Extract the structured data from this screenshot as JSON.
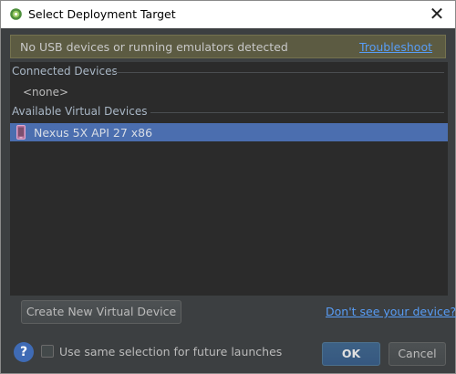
{
  "window": {
    "title": "Select Deployment Target",
    "close_glyph": "✕"
  },
  "banner": {
    "message": "No USB devices or running emulators detected",
    "link": "Troubleshoot"
  },
  "connected_devices": {
    "header": "Connected Devices",
    "empty_label": "<none>"
  },
  "available_virtual_devices": {
    "header": "Available Virtual Devices",
    "items": [
      {
        "label": "Nexus 5X API 27 x86",
        "icon": "phone-icon",
        "selected": true
      }
    ]
  },
  "actions": {
    "create_button": "Create New Virtual Device",
    "help_link": "Don't see your device?",
    "help_icon_glyph": "?",
    "checkbox_label": "Use same selection for future launches",
    "checkbox_checked": false,
    "ok_button": "OK",
    "cancel_button": "Cancel"
  },
  "colors": {
    "dialog_bg": "#3c3f41",
    "list_bg": "#2b2b2b",
    "selection": "#4b6eaf",
    "banner_bg": "#5c5b42",
    "link": "#589df6",
    "default_button": "#365880"
  }
}
